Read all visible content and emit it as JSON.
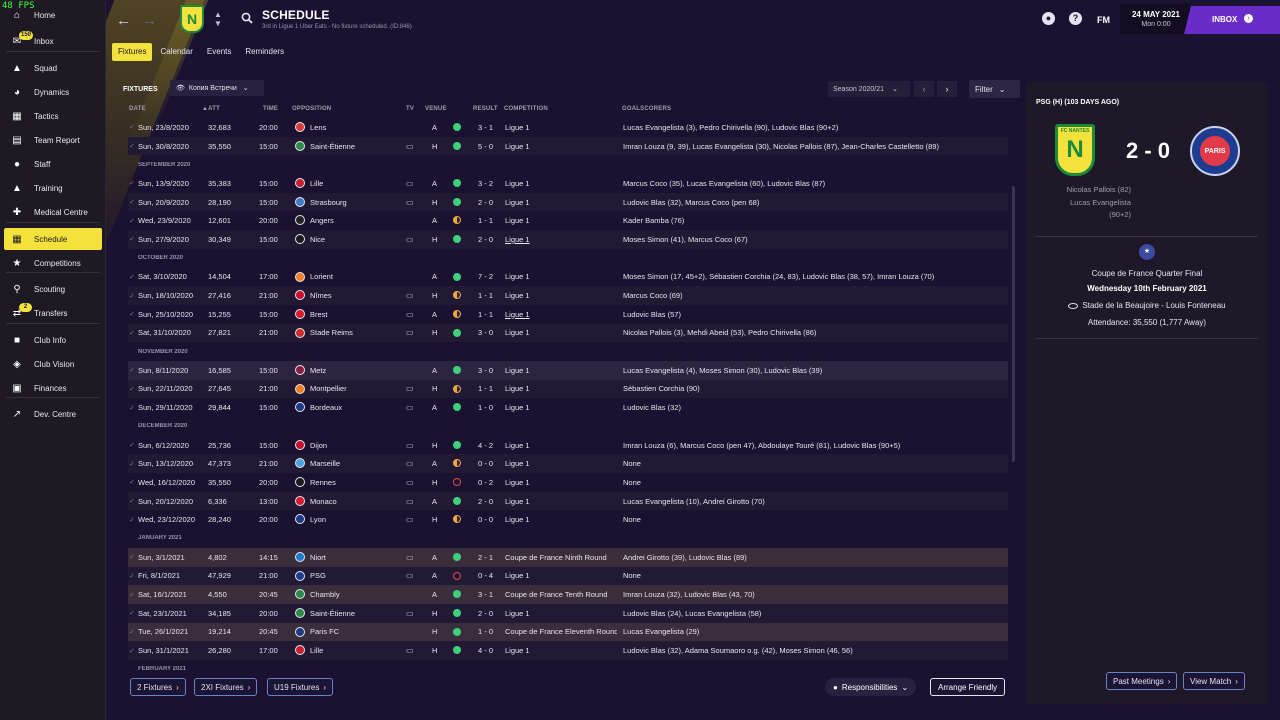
{
  "fps": "48 FPS",
  "sidebar": {
    "items": [
      {
        "label": "Home",
        "icon": "home-icon"
      },
      {
        "label": "Inbox",
        "icon": "inbox-icon",
        "badge": "150"
      },
      {
        "label": "Squad",
        "icon": "shirt-icon"
      },
      {
        "label": "Dynamics",
        "icon": "dynamics-icon"
      },
      {
        "label": "Tactics",
        "icon": "tactics-board-icon"
      },
      {
        "label": "Team Report",
        "icon": "report-icon"
      },
      {
        "label": "Staff",
        "icon": "staff-icon"
      },
      {
        "label": "Training",
        "icon": "training-cone-icon"
      },
      {
        "label": "Medical Centre",
        "icon": "medical-kit-icon"
      },
      {
        "label": "Schedule",
        "icon": "calendar-icon",
        "active": true
      },
      {
        "label": "Competitions",
        "icon": "trophy-icon"
      },
      {
        "label": "Scouting",
        "icon": "scouting-search-icon"
      },
      {
        "label": "Transfers",
        "icon": "transfers-icon",
        "badge": "2"
      },
      {
        "label": "Club Info",
        "icon": "club-info-icon"
      },
      {
        "label": "Club Vision",
        "icon": "club-vision-icon"
      },
      {
        "label": "Finances",
        "icon": "finances-icon"
      },
      {
        "label": "Dev. Centre",
        "icon": "dev-centre-icon"
      }
    ]
  },
  "header": {
    "title": "SCHEDULE",
    "subtitle": "3rd in Ligue 1 Uber Eats - No fixture scheduled. (ID:846)",
    "crest_text": "N",
    "crest_top": "FC NANTES",
    "fm": "FM",
    "date": "24 MAY 2021",
    "time": "Mon 0:00",
    "inbox": "INBOX"
  },
  "tabs": [
    "Fixtures",
    "Calendar",
    "Events",
    "Reminders"
  ],
  "fixtures": {
    "heading": "FIXTURES",
    "view": "Копия Встречи",
    "season": "Season 2020/21",
    "filter": "Filter",
    "columns": {
      "date": "DATE",
      "att": "ATT",
      "time": "TIME",
      "opposition": "OPPOSITION",
      "tv": "TV",
      "venue": "VENUE",
      "result": "RESULT",
      "competition": "COMPETITION",
      "goalscorers": "GOALSCORERS"
    },
    "rows": [
      {
        "date": "Sun, 23/8/2020",
        "att": "32,683",
        "time": "20:00",
        "opp": "Lens",
        "tv": false,
        "venue": "A",
        "outcome": "win",
        "res": "3 - 1",
        "comp": "Ligue 1",
        "goals": "Lucas Evangelista (3), Pedro Chirivella (90), Ludovic Blas (90+2)"
      },
      {
        "date": "Sun, 30/8/2020",
        "att": "35,550",
        "time": "15:00",
        "opp": "Saint-Étienne",
        "tv": true,
        "venue": "H",
        "outcome": "win",
        "res": "5 - 0",
        "comp": "Ligue 1",
        "goals": "Imran Louza (9, 39), Lucas Evangelista (30), Nicolas Pallois (87), Jean-Charles Castelletto (89)"
      },
      {
        "month": "SEPTEMBER 2020"
      },
      {
        "date": "Sun, 13/9/2020",
        "att": "35,383",
        "time": "15:00",
        "opp": "Lille",
        "tv": true,
        "venue": "A",
        "outcome": "win",
        "res": "3 - 2",
        "comp": "Ligue 1",
        "goals": "Marcus Coco (35), Lucas Evangelista (60), Ludovic Blas (87)"
      },
      {
        "date": "Sun, 20/9/2020",
        "att": "28,190",
        "time": "15:00",
        "opp": "Strasbourg",
        "tv": true,
        "venue": "H",
        "outcome": "win",
        "res": "2 - 0",
        "comp": "Ligue 1",
        "goals": "Ludovic Blas (32), Marcus Coco (pen 68)"
      },
      {
        "date": "Wed, 23/9/2020",
        "att": "12,601",
        "time": "20:00",
        "opp": "Angers",
        "tv": false,
        "venue": "A",
        "outcome": "draw",
        "res": "1 - 1",
        "comp": "Ligue 1",
        "goals": "Kader Bamba (76)"
      },
      {
        "date": "Sun, 27/9/2020",
        "att": "30,349",
        "time": "15:00",
        "opp": "Nice",
        "tv": true,
        "venue": "H",
        "outcome": "win",
        "res": "2 - 0",
        "comp": "Ligue 1",
        "comp_u": true,
        "goals": "Moses Simon (41), Marcus Coco (67)"
      },
      {
        "month": "OCTOBER 2020"
      },
      {
        "date": "Sat, 3/10/2020",
        "att": "14,504",
        "time": "17:00",
        "opp": "Lorient",
        "tv": false,
        "venue": "A",
        "outcome": "win",
        "res": "7 - 2",
        "comp": "Ligue 1",
        "goals": "Moses Simon (17, 45+2), Sébastien Corchia (24, 83), Ludovic Blas (38, 57), Imran Louza (70)"
      },
      {
        "date": "Sun, 18/10/2020",
        "att": "27,416",
        "time": "21:00",
        "opp": "Nîmes",
        "tv": true,
        "venue": "H",
        "outcome": "draw",
        "res": "1 - 1",
        "comp": "Ligue 1",
        "goals": "Marcus Coco (69)"
      },
      {
        "date": "Sun, 25/10/2020",
        "att": "15,255",
        "time": "15:00",
        "opp": "Brest",
        "tv": true,
        "venue": "A",
        "outcome": "draw",
        "res": "1 - 1",
        "comp": "Ligue 1",
        "comp_u": true,
        "goals": "Ludovic Blas (57)"
      },
      {
        "date": "Sat, 31/10/2020",
        "att": "27,821",
        "time": "21:00",
        "opp": "Stade Reims",
        "tv": true,
        "venue": "H",
        "outcome": "win",
        "res": "3 - 0",
        "comp": "Ligue 1",
        "goals": "Nicolas Pallois (3), Mehdi Abeid (53), Pedro Chirivella (86)"
      },
      {
        "month": "NOVEMBER 2020"
      },
      {
        "date": "Sun, 8/11/2020",
        "att": "16,585",
        "time": "15:00",
        "opp": "Metz",
        "tv": false,
        "venue": "A",
        "outcome": "win",
        "res": "3 - 0",
        "comp": "Ligue 1",
        "goals": "Lucas Evangelista (4), Moses Simon (30), Ludovic Blas (39)",
        "sel": true
      },
      {
        "date": "Sun, 22/11/2020",
        "att": "27,645",
        "time": "21:00",
        "opp": "Montpellier",
        "tv": true,
        "venue": "H",
        "outcome": "draw",
        "res": "1 - 1",
        "comp": "Ligue 1",
        "goals": "Sébastien Corchia (90)"
      },
      {
        "date": "Sun, 29/11/2020",
        "att": "29,844",
        "time": "15:00",
        "opp": "Bordeaux",
        "tv": true,
        "venue": "A",
        "outcome": "win",
        "res": "1 - 0",
        "comp": "Ligue 1",
        "goals": "Ludovic Blas (32)"
      },
      {
        "month": "DECEMBER 2020"
      },
      {
        "date": "Sun, 6/12/2020",
        "att": "25,736",
        "time": "15:00",
        "opp": "Dijon",
        "tv": true,
        "venue": "H",
        "outcome": "win",
        "res": "4 - 2",
        "comp": "Ligue 1",
        "goals": "Imran Louza (6), Marcus Coco (pen 47), Abdoulaye Touré (81), Ludovic Blas (90+5)"
      },
      {
        "date": "Sun, 13/12/2020",
        "att": "47,373",
        "time": "21:00",
        "opp": "Marseille",
        "tv": true,
        "venue": "A",
        "outcome": "draw",
        "res": "0 - 0",
        "comp": "Ligue 1",
        "goals": "None"
      },
      {
        "date": "Wed, 16/12/2020",
        "att": "35,550",
        "time": "20:00",
        "opp": "Rennes",
        "tv": true,
        "venue": "H",
        "outcome": "loss",
        "res": "0 - 2",
        "comp": "Ligue 1",
        "goals": "None"
      },
      {
        "date": "Sun, 20/12/2020",
        "att": "6,336",
        "time": "13:00",
        "opp": "Monaco",
        "tv": true,
        "venue": "A",
        "outcome": "win",
        "res": "2 - 0",
        "comp": "Ligue 1",
        "goals": "Lucas Evangelista (10), Andrei Girotto (70)"
      },
      {
        "date": "Wed, 23/12/2020",
        "att": "28,240",
        "time": "20:00",
        "opp": "Lyon",
        "tv": true,
        "venue": "H",
        "outcome": "draw",
        "res": "0 - 0",
        "comp": "Ligue 1",
        "goals": "None"
      },
      {
        "month": "JANUARY 2021"
      },
      {
        "date": "Sun, 3/1/2021",
        "att": "4,802",
        "time": "14:15",
        "opp": "Niort",
        "tv": true,
        "venue": "A",
        "outcome": "win",
        "res": "2 - 1",
        "comp": "Coupe de France Ninth Round",
        "goals": "Andrei Girotto (39), Ludovic Blas (89)",
        "hl": true
      },
      {
        "date": "Fri, 8/1/2021",
        "att": "47,929",
        "time": "21:00",
        "opp": "PSG",
        "tv": true,
        "venue": "A",
        "outcome": "loss",
        "res": "0 - 4",
        "comp": "Ligue 1",
        "goals": "None"
      },
      {
        "date": "Sat, 16/1/2021",
        "att": "4,550",
        "time": "20:45",
        "opp": "Chambly",
        "tv": false,
        "venue": "A",
        "outcome": "win",
        "res": "3 - 1",
        "comp": "Coupe de France Tenth Round",
        "goals": "Imran Louza (32), Ludovic Blas (43, 70)",
        "hl": true
      },
      {
        "date": "Sat, 23/1/2021",
        "att": "34,185",
        "time": "20:00",
        "opp": "Saint-Étienne",
        "tv": true,
        "venue": "H",
        "outcome": "win",
        "res": "2 - 0",
        "comp": "Ligue 1",
        "goals": "Ludovic Blas (24), Lucas Evangelista (58)"
      },
      {
        "date": "Tue, 26/1/2021",
        "att": "19,214",
        "time": "20:45",
        "opp": "Paris FC",
        "tv": false,
        "venue": "H",
        "outcome": "win",
        "res": "1 - 0",
        "comp": "Coupe de France Eleventh Round",
        "goals": "Lucas Evangelista (29)",
        "hl": true
      },
      {
        "date": "Sun, 31/1/2021",
        "att": "26,280",
        "time": "17:00",
        "opp": "Lille",
        "tv": true,
        "venue": "H",
        "outcome": "win",
        "res": "4 - 0",
        "comp": "Ligue 1",
        "goals": "Ludovic Blas (32), Adama Soumaoro o.g. (42), Moses Simon (46, 56)"
      },
      {
        "month": "FEBRUARY 2021"
      }
    ]
  },
  "footer": {
    "btn1": "2 Fixtures",
    "btn2": "2XI Fixtures",
    "btn3": "U19 Fixtures",
    "responsibilities": "Responsibilities",
    "arrange": "Arrange Friendly"
  },
  "panel": {
    "title": "PSG (H) (103 DAYS AGO)",
    "home_crest": "N",
    "home_crest_top": "FC NANTES",
    "score": "2 - 0",
    "away_crest": "PARIS",
    "scorers": [
      "Nicolas Pallois (82)",
      "Lucas Evangelista",
      "(90+2)"
    ],
    "competition": "Coupe de France Quarter Final",
    "date": "Wednesday 10th February 2021",
    "stadium": "Stade de la Beaujoire - Louis Fonteneau",
    "attendance": "Attendance: 35,550 (1,777 Away)",
    "past_meetings": "Past Meetings",
    "view_match": "View Match"
  },
  "colors": {
    "accent": "#f3e13c",
    "inbox": "#6a2cc8",
    "win": "#3ecf7a",
    "draw": "#f0a93a",
    "loss": "#e04a4a",
    "cup_row": "#3a2d3c"
  }
}
